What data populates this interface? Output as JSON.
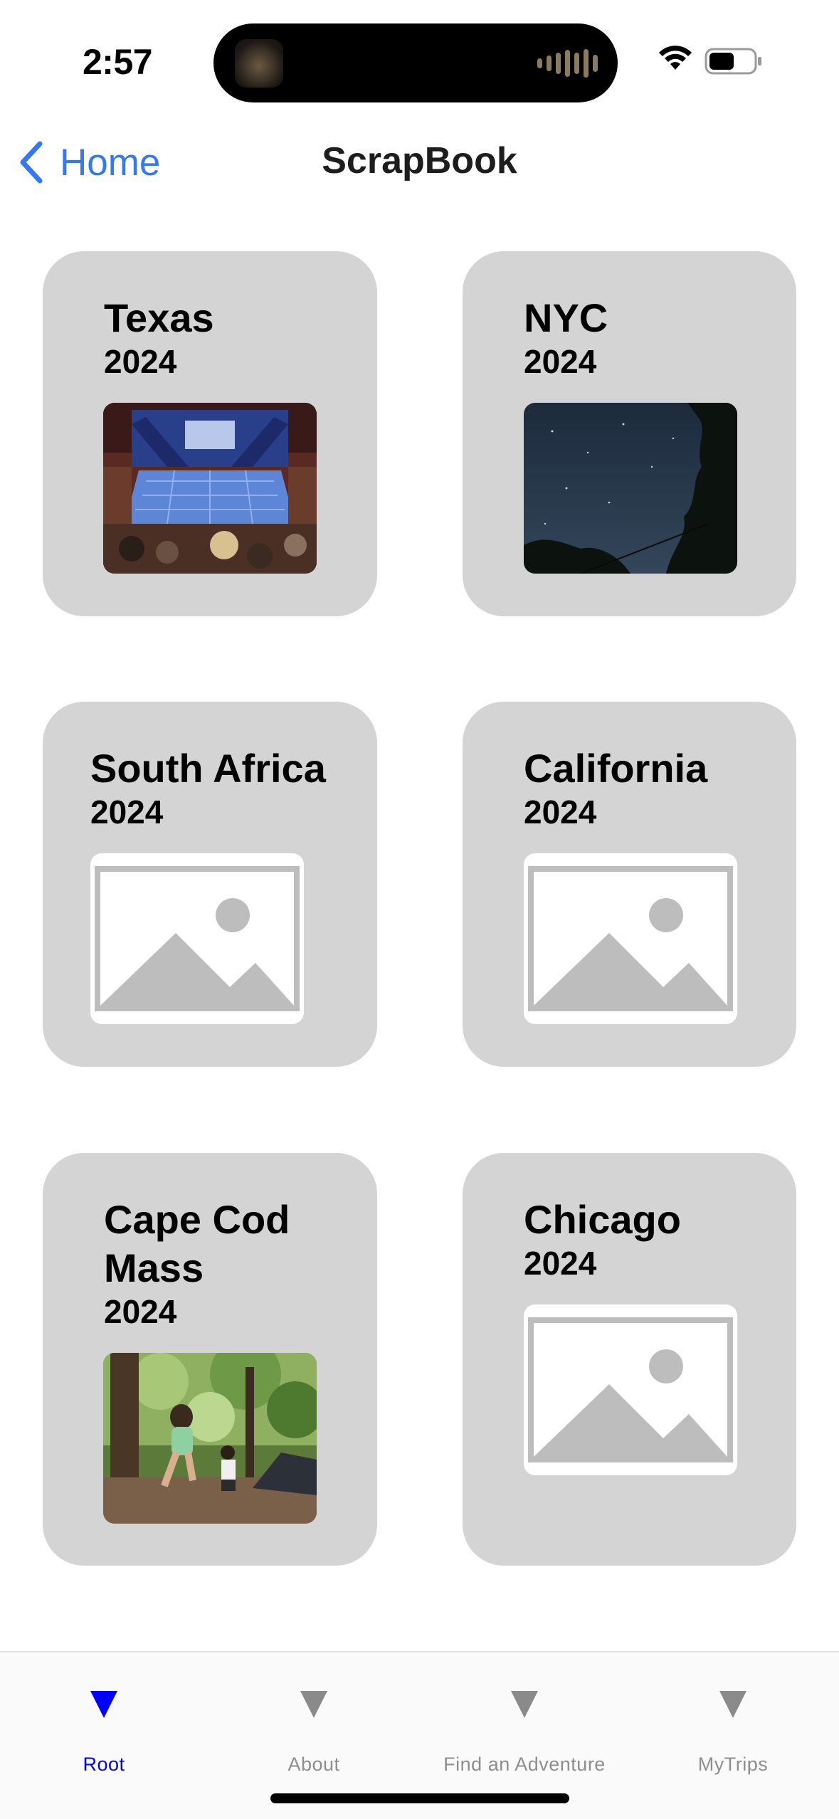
{
  "status_bar": {
    "time": "2:57",
    "icons": [
      "wifi-icon",
      "battery-icon"
    ]
  },
  "nav": {
    "back_label": "Home",
    "title": "ScrapBook"
  },
  "trips": [
    {
      "name": "Texas",
      "year": "2024",
      "image": "photo-theater"
    },
    {
      "name": "NYC",
      "year": "2024",
      "image": "photo-night-sky"
    },
    {
      "name": "South Africa",
      "year": "2024",
      "image": "placeholder-image-icon"
    },
    {
      "name": "California",
      "year": "2024",
      "image": "placeholder-image-icon"
    },
    {
      "name": "Cape Cod Mass",
      "year": "2024",
      "image": "photo-forest"
    },
    {
      "name": "Chicago",
      "year": "2024",
      "image": "placeholder-image-icon"
    }
  ],
  "tabs": [
    {
      "label": "Root",
      "active": true
    },
    {
      "label": "About",
      "active": false
    },
    {
      "label": "Find an Adventure",
      "active": false
    },
    {
      "label": "MyTrips",
      "active": false
    }
  ],
  "colors": {
    "accent_blue": "#3478f6",
    "tab_active": "#0000ff",
    "tab_inactive": "#8e8e8e",
    "card_bg": "#d4d4d4"
  }
}
